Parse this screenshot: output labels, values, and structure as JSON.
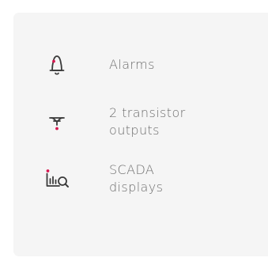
{
  "colors": {
    "panel_bg": "#f5f5f5",
    "icon_stroke": "#3a3a3a",
    "accent": "#d6164f",
    "text": "#6e6e6e"
  },
  "features": [
    {
      "icon": "bell-icon",
      "lines": [
        "Alarms"
      ]
    },
    {
      "icon": "transistor-icon",
      "lines": [
        "2 transistor",
        "outputs"
      ]
    },
    {
      "icon": "chart-search-icon",
      "lines": [
        "SCADA",
        "displays"
      ]
    }
  ]
}
